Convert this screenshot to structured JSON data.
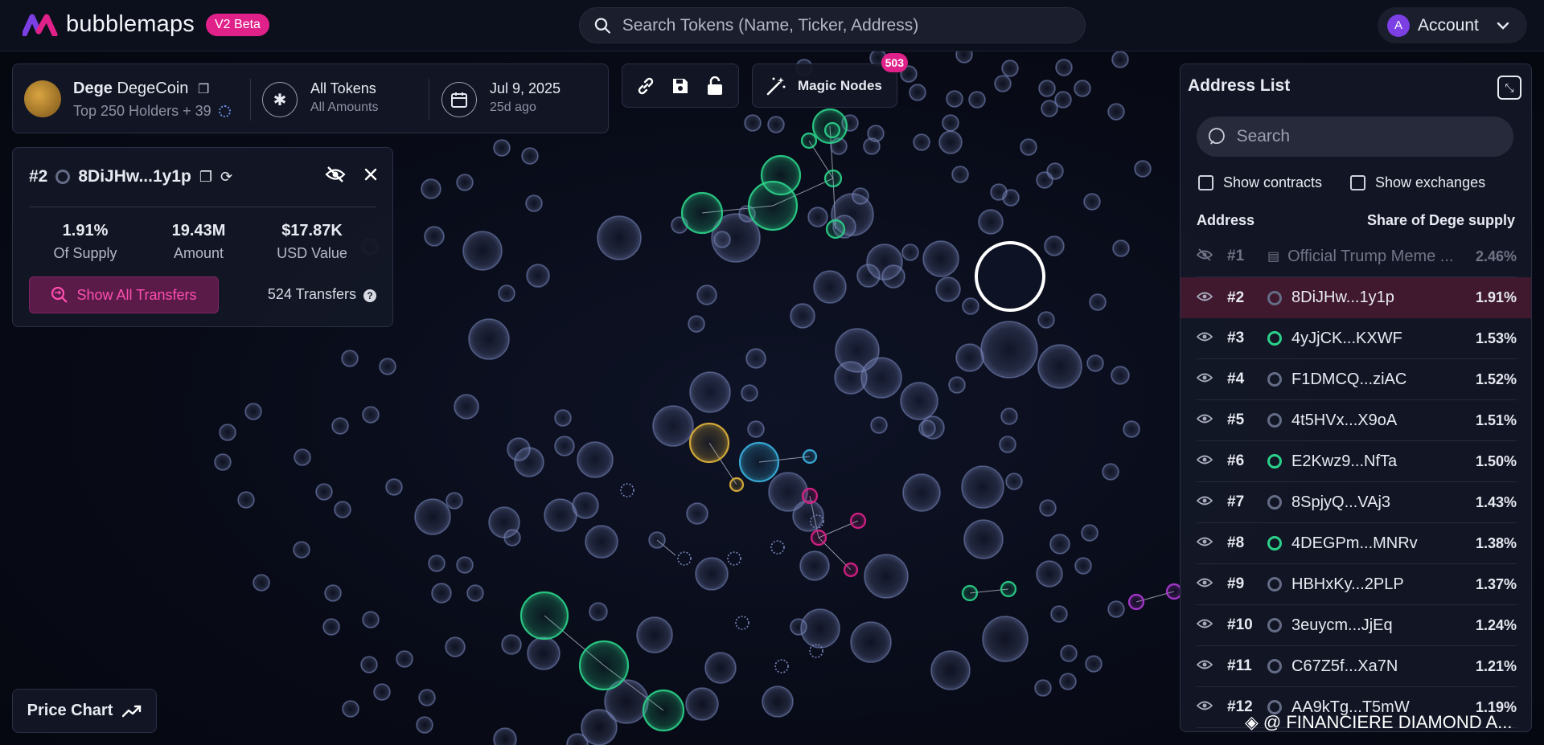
{
  "app": {
    "name": "bubblemaps",
    "beta_badge": "V2 Beta",
    "brand_color": "#e0218a"
  },
  "search": {
    "placeholder": "Search Tokens (Name, Ticker, Address)"
  },
  "account": {
    "initial": "A",
    "label": "Account"
  },
  "token": {
    "ticker": "Dege",
    "name": "DegeCoin",
    "holders_text": "Top 250 Holders + 39",
    "filter_title": "All Tokens",
    "filter_sub": "All Amounts",
    "date": "Jul 9, 2025",
    "date_ago": "25d ago"
  },
  "toolbar": {
    "link_icon": "link-icon",
    "save_icon": "save-icon",
    "lock_icon": "lock-icon"
  },
  "magic_nodes": {
    "label": "Magic Nodes",
    "count": "503"
  },
  "holder": {
    "rank": "#2",
    "address": "8DiJHw...1y1p",
    "supply": "1.91%",
    "supply_label": "Of Supply",
    "amount": "19.43M",
    "amount_label": "Amount",
    "usd": "$17.87K",
    "usd_label": "USD Value",
    "transfers_button": "Show All Transfers",
    "transfers_count": "524 Transfers"
  },
  "price_chart": {
    "label": "Price Chart"
  },
  "address_list": {
    "title": "Address List",
    "search_placeholder": "Search",
    "show_contracts": "Show contracts",
    "show_exchanges": "Show exchanges",
    "col_address": "Address",
    "col_share": "Share of Dege supply",
    "rows": [
      {
        "rank": "#1",
        "address": "Official Trump Meme ...",
        "pct": "2.46%",
        "state": "hidden"
      },
      {
        "rank": "#2",
        "address": "8DiJHw...1y1p",
        "pct": "1.91%",
        "state": "selected"
      },
      {
        "rank": "#3",
        "address": "4yJjCK...KXWF",
        "pct": "1.53%",
        "dot": "green"
      },
      {
        "rank": "#4",
        "address": "F1DMCQ...ziAC",
        "pct": "1.52%",
        "dot": "gray"
      },
      {
        "rank": "#5",
        "address": "4t5HVx...X9oA",
        "pct": "1.51%",
        "dot": "gray"
      },
      {
        "rank": "#6",
        "address": "E2Kwz9...NfTa",
        "pct": "1.50%",
        "dot": "green"
      },
      {
        "rank": "#7",
        "address": "8SpjyQ...VAj3",
        "pct": "1.43%",
        "dot": "gray"
      },
      {
        "rank": "#8",
        "address": "4DEGPm...MNRv",
        "pct": "1.38%",
        "dot": "green"
      },
      {
        "rank": "#9",
        "address": "HBHxKy...2PLP",
        "pct": "1.37%",
        "dot": "gray"
      },
      {
        "rank": "#10",
        "address": "3euycm...JjEq",
        "pct": "1.24%",
        "dot": "gray"
      },
      {
        "rank": "#11",
        "address": "C67Z5f...Xa7N",
        "pct": "1.21%",
        "dot": "gray"
      },
      {
        "rank": "#12",
        "address": "AA9kTg...T5mW",
        "pct": "1.19%",
        "dot": "gray"
      }
    ]
  },
  "watermark": "@ FINANCIERE DIAMOND A...",
  "colors": {
    "gray": "#646c86",
    "green": "#2bd18a",
    "yellow": "#e0b33a",
    "cyan": "#3ab3e0",
    "pink": "#e0218a",
    "purple": "#b13ad9"
  }
}
